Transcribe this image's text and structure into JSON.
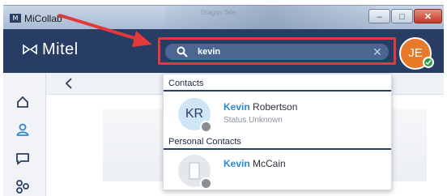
{
  "window": {
    "app_badge": "M",
    "title": "MiCollab",
    "background_blurred_text": "Dragon Tale"
  },
  "header": {
    "logo_text": "Mitel",
    "search": {
      "value": "kevin",
      "placeholder": "Search"
    },
    "user_avatar_initials": "JE",
    "user_presence": "available"
  },
  "results": {
    "sections": [
      {
        "heading": "Contacts",
        "items": [
          {
            "avatar_initials": "KR",
            "name_match": "Kevin",
            "name_rest": " Robertson",
            "status": "Status Unknown"
          }
        ]
      },
      {
        "heading": "Personal Contacts",
        "items": [
          {
            "avatar_initials": "",
            "name_match": "Kevin",
            "name_rest": " McCain",
            "status": ""
          }
        ]
      }
    ]
  },
  "rail": {
    "items": [
      "home-icon",
      "contacts-icon",
      "chat-icon",
      "groups-icon"
    ]
  },
  "colors": {
    "header_bg": "#283d63",
    "highlight_border": "#e2393a",
    "avatar_bg": "#e8792b",
    "presence_green": "#2f9e44",
    "match_blue": "#2d88d1"
  }
}
